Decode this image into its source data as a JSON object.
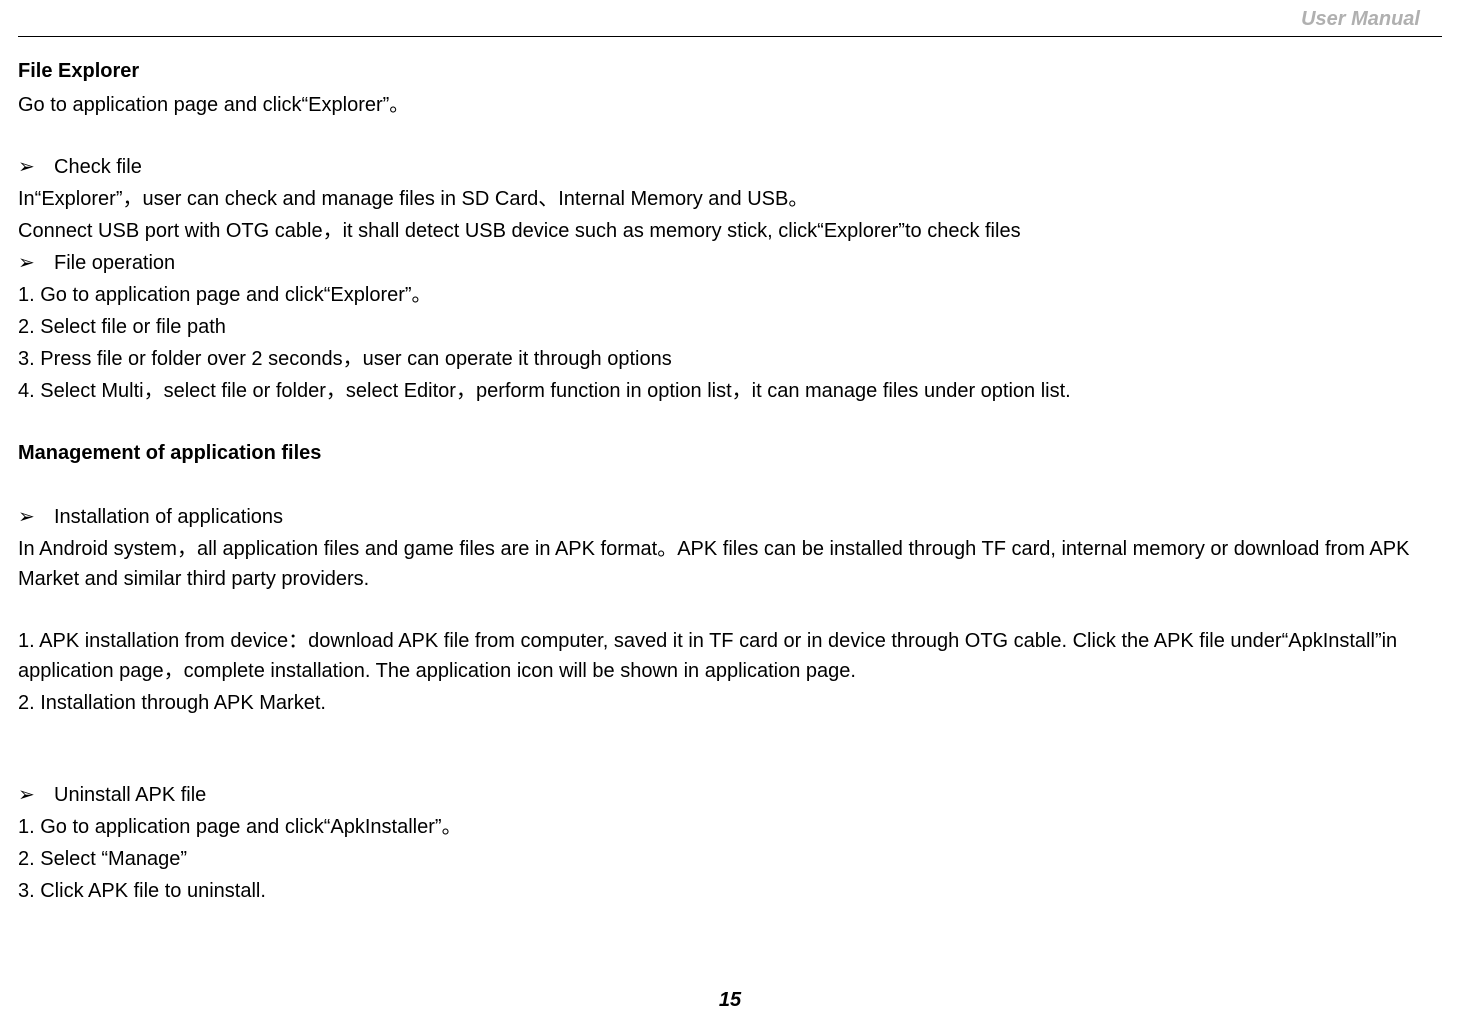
{
  "header": {
    "right_label": "User Manual"
  },
  "section1": {
    "title": "File Explorer",
    "intro": "Go to application page and click“Explorer”。",
    "bullet1": "Check file",
    "p1": "In“Explorer”，user can check and manage files in SD Card、Internal Memory and USB。",
    "p2": "Connect USB port with OTG cable，it shall detect USB device such as memory stick, click“Explorer”to check files",
    "bullet2": "File operation",
    "step1": "1. Go to application page and click“Explorer”。",
    "step2": "2. Select file or file path",
    "step3": "3. Press file or folder over 2 seconds，user can operate it through options",
    "step4": "4. Select Multi，select file or folder，select Editor，perform function in option list，it can manage files under option list."
  },
  "section2": {
    "title": "Management of application files",
    "bullet1": "Installation of applications",
    "p1": "In Android system，all application files and game files are in APK format。APK files can be installed through TF card, internal memory or download from APK Market and similar third party providers.",
    "p2": "1. APK installation from device：download APK file from computer, saved it in TF card or in device through OTG cable. Click the APK file under“ApkInstall”in application page，complete installation. The application icon will be shown in application page.",
    "p3": "2. Installation through APK Market.",
    "bullet2": "Uninstall APK file",
    "u1": "1. Go to application page and click“ApkInstaller”。",
    "u2": "2. Select “Manage”",
    "u3": "3. Click APK file to uninstall."
  },
  "footer": {
    "page_number": "15"
  },
  "glyphs": {
    "triangle": "➢"
  }
}
